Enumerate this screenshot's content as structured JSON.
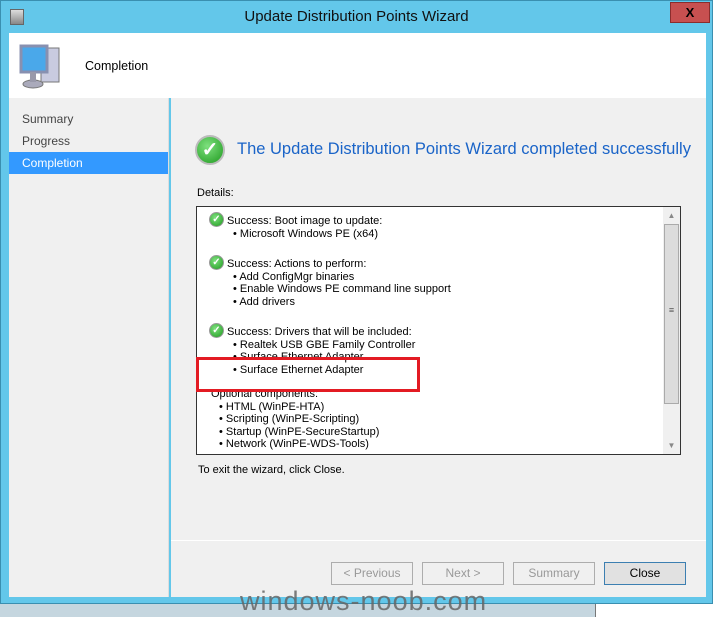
{
  "window": {
    "title": "Update Distribution Points Wizard",
    "close_label": "X"
  },
  "header": {
    "page_title": "Completion"
  },
  "sidebar": {
    "items": [
      {
        "label": "Summary"
      },
      {
        "label": "Progress"
      },
      {
        "label": "Completion",
        "selected": true
      }
    ]
  },
  "main": {
    "headline": "The Update Distribution Points Wizard completed successfully",
    "details_label": "Details:",
    "sections": [
      {
        "title": "Success: Boot image to update:",
        "items": [
          "Microsoft Windows PE (x64)"
        ]
      },
      {
        "title": "Success: Actions to perform:",
        "items": [
          "Add ConfigMgr binaries",
          "Enable Windows PE command line support",
          "Add drivers"
        ]
      },
      {
        "title": "Success: Drivers that will be included:",
        "items": [
          "Realtek USB GBE Family Controller",
          "Surface Ethernet Adapter",
          "Surface Ethernet Adapter"
        ]
      }
    ],
    "optional": {
      "title": "Optional components:",
      "items": [
        "HTML (WinPE-HTA)",
        "Scripting (WinPE-Scripting)",
        "Startup (WinPE-SecureStartup)",
        "Network (WinPE-WDS-Tools)"
      ]
    },
    "exit_text": "To exit the wizard, click Close."
  },
  "buttons": {
    "previous": "< Previous",
    "next": "Next >",
    "summary": "Summary",
    "close": "Close"
  },
  "watermark": "windows-noob.com",
  "colors": {
    "frame": "#63c7ea",
    "accent": "#3399ff",
    "headline": "#1a64c8",
    "highlight": "#e31b23"
  }
}
